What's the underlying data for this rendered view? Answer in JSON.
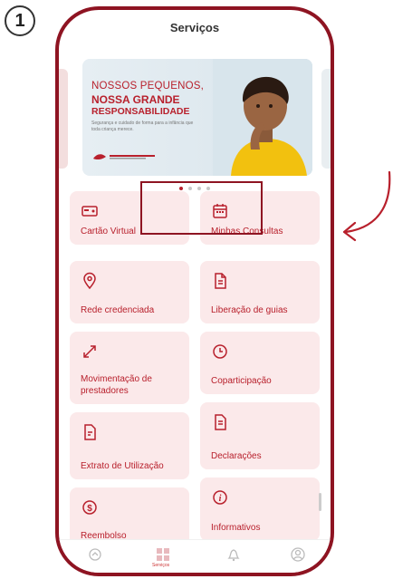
{
  "step_number": "1",
  "header": {
    "title": "Serviços"
  },
  "banner": {
    "line1": "NOSSOS PEQUENOS,",
    "line2": "NOSSA GRANDE",
    "line3": "RESPONSABILIDADE",
    "small_text": "Segurança e cuidado de forma para a infância que toda criança merece."
  },
  "carousel": {
    "total": 4,
    "active_index": 0
  },
  "services": [
    {
      "label": "Cartão Virtual",
      "icon": "card-icon"
    },
    {
      "label": "Minhas Consultas",
      "icon": "calendar-icon"
    },
    {
      "label": "Rede credenciada",
      "icon": "location-pin-icon"
    },
    {
      "label": "Liberação de guias",
      "icon": "document-icon"
    },
    {
      "label": "Movimentação de prestadores",
      "icon": "arrows-icon"
    },
    {
      "label": "Coparticipação",
      "icon": "clock-icon"
    },
    {
      "label": "Extrato de Utilização",
      "icon": "receipt-icon"
    },
    {
      "label": "Declarações",
      "icon": "document-icon"
    },
    {
      "label": "Reembolso",
      "icon": "money-icon"
    },
    {
      "label": "Informativos",
      "icon": "info-icon"
    }
  ],
  "tabs": [
    {
      "label": "",
      "icon": "home-icon"
    },
    {
      "label": "Serviços",
      "icon": "grid-icon",
      "active": true
    },
    {
      "label": "",
      "icon": "bell-icon"
    },
    {
      "label": "",
      "icon": "profile-icon"
    }
  ],
  "colors": {
    "brand_red": "#b8202c",
    "frame_dark_red": "#8e1422",
    "card_bg": "#fbe9ea"
  }
}
